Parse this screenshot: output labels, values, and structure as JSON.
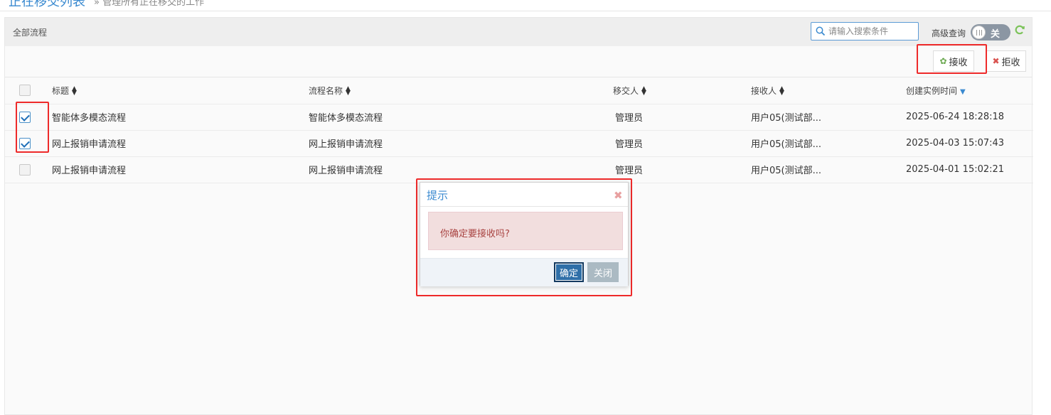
{
  "header": {
    "title": "正在移交列表",
    "subtitle": "» 管理所有正在移交的工作"
  },
  "panel": {
    "title": "全部流程",
    "search_placeholder": "请输入搜索条件",
    "advanced_query_label": "高级查询",
    "toggle_state": "关"
  },
  "toolbar": {
    "accept_label": "接收",
    "reject_label": "拒收"
  },
  "table": {
    "columns": [
      "标题",
      "流程名称",
      "移交人",
      "接收人",
      "创建实例时间"
    ],
    "sorted_column": "创建实例时间",
    "rows": [
      {
        "checked": true,
        "title": "智能体多模态流程",
        "process": "智能体多模态流程",
        "transferor": "管理员",
        "receiver": "用户05(测试部...",
        "created": "2025-06-24 18:28:18"
      },
      {
        "checked": true,
        "title": "网上报销申请流程",
        "process": "网上报销申请流程",
        "transferor": "管理员",
        "receiver": "用户05(测试部...",
        "created": "2025-04-03 15:07:43"
      },
      {
        "checked": false,
        "title": "网上报销申请流程",
        "process": "网上报销申请流程",
        "transferor": "管理员",
        "receiver": "用户05(测试部...",
        "created": "2025-04-01 15:02:21"
      }
    ]
  },
  "dialog": {
    "title": "提示",
    "message": "你确定要接收吗?",
    "ok_label": "确定",
    "close_label": "关闭"
  },
  "colors": {
    "accent": "#3a8ad0",
    "highlight_box": "#ee2a2a",
    "alert_bg": "#f2dede",
    "alert_text": "#a94442",
    "ok_button": "#2f6fa8",
    "close_button": "#abbac3"
  }
}
